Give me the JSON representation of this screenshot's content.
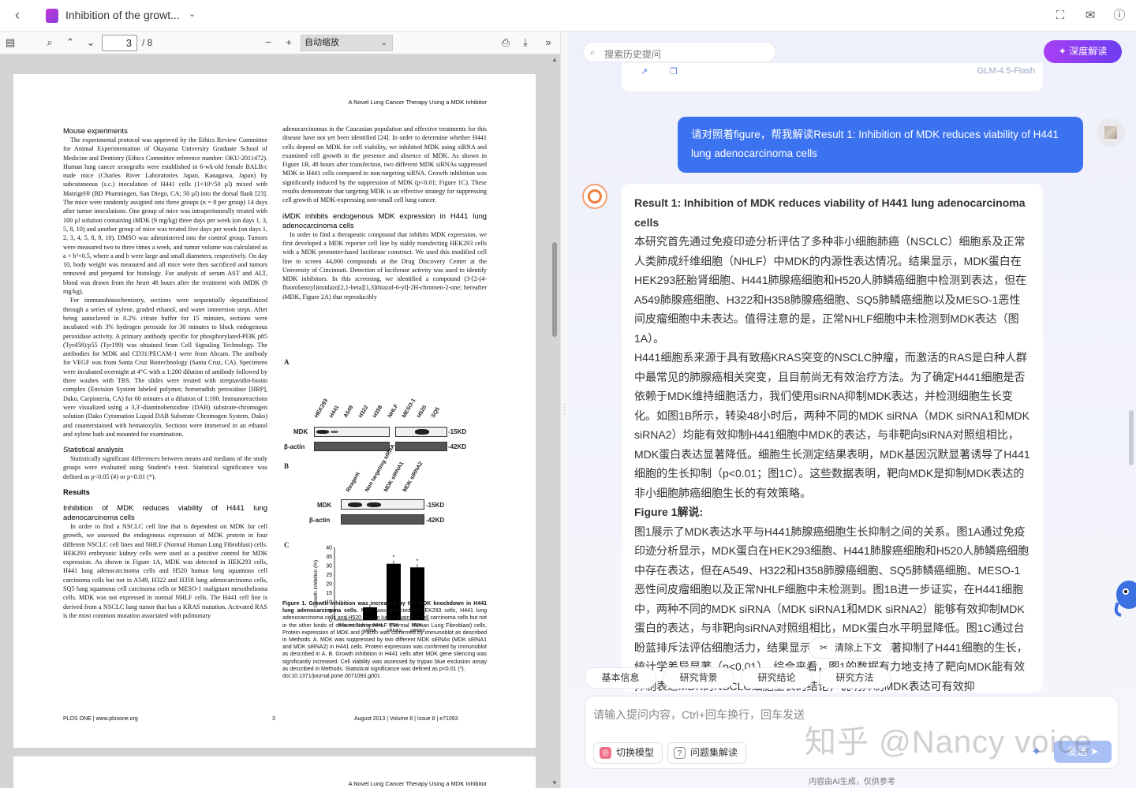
{
  "window": {
    "doc_title": "Inhibition of the growt...",
    "icons": [
      "back-icon",
      "fullscreen-icon",
      "feedback-icon",
      "help-icon"
    ]
  },
  "pdf_toolbar": {
    "page_current": "3",
    "page_total": "/ 8",
    "zoom_label": "自动缩放"
  },
  "pdf": {
    "running_head": "A Novel Lung Cancer Therapy Using a MDK Inhibitor",
    "col1": [
      {
        "type": "h",
        "text": "Mouse experiments"
      },
      {
        "type": "p",
        "text": "The experimental protocol was approved by the Ethics Review Committee for Animal Experimentation of Okayama University Graduate School of Medicine and Dentistry (Ethics Committee reference number: OKU-2011472). Human lung cancer xenografts were established in 6-wk-old female BALB/c nude mice (Charles River Laboratories Japan, Kanagawa, Japan) by subcutaneous (s.c.) inoculation of H441 cells (1×10⁶/50 µl) mixed with Matrigel® (BD Pharmingen, San Diego, CA; 50 µl) into the dorsal flank [23]. The mice were randomly assigned into three groups (n = 8 per group) 14 days after tumor inoculations. One group of mice was intraperitoneally treated with 100 µl solution containing iMDK (9 mg/kg) three days per week (on days 1, 3, 5, 8, 10) and another group of mice was treated five days per week (on days 1, 2, 3, 4, 5, 8, 9, 10). DMSO was administered into the control group. Tumors were measured two to three times a week, and tumor volume was calculated as a × b²×0.5, where a and b were large and small diameters, respectively. On day 10, body weight was measured and all mice were then sacrificed and tumors removed and prepared for histology. For analysis of serum AST and ALT, blood was drawn from the heart 48 hours after the treatment with iMDK (9 mg/kg)."
      },
      {
        "type": "p",
        "text": "For immunohistochemistry, sections were sequentially deparaffinized through a series of xylene, graded ethanol, and water immersion steps. After being autoclaved in 0.2% citrate buffer for 15 minutes, sections were incubated with 3% hydrogen peroxide for 30 minutes to block endogenous peroxidase activity. A primary antibody specific for phosphorylated-PI3K p85 (Tyr458)/p55 (Tyr199) was obtained from Cell Signaling Technology. The antibodies for MDK and CD31/PECAM-1 were from Abcam. The antibody for VEGF was from Santa Cruz Biotechnology (Santa Cruz, CA). Specimens were incubated overnight at 4°C with a 1:200 dilution of antibody followed by three washes with TBS. The slides were treated with streptavidin-biotin complex (Envision System labeled polymer, horseradish peroxidase [HRP], Dako, Carpinteria, CA) for 60 minutes at a dilution of 1:100. Immunoreactions were visualized using a 3,3′-diaminobenzidine (DAB) substrate-chromogen solution (Dako Cytomation Liquid DAB Substrate Chromogen System, Dako) and counterstained with hematoxylin. Sections were immersed in an ethanol and xylene bath and mounted for examination."
      },
      {
        "type": "h",
        "text": "Statistical analysis"
      },
      {
        "type": "p",
        "text": "Statistically significant differences between means and medians of the study groups were evaluated using Student's t-test. Statistical significance was defined as p<0.05 (#) or p<0.01 (*)."
      },
      {
        "type": "hb",
        "text": "Results"
      },
      {
        "type": "h",
        "text": "Inhibition of MDK reduces viability of H441 lung adenocarcinoma cells"
      },
      {
        "type": "p",
        "text": "In order to find a NSCLC cell line that is dependent on MDK for cell growth, we assessed the endogenous expression of MDK protein in four different NSCLC cell lines and NHLF (Normal Human Lung Fibroblast) cells. HEK293 embryonic kidney cells were used as a positive control for MDK expression. As shown in Figure 1A, MDK was detected in HEK293 cells, H441 lung adenocarcinoma cells and H520 human lung squamous cell carcinoma cells but not in A549, H322 and H358 lung adenocarcinoma cells, SQ5 lung squamous cell carcinoma cells or MESO-1 malignant mesothelioma cells. MDK was not expressed in normal NHLF cells. The H441 cell line is derived from a NSCLC lung tumor that has a KRAS mutation. Activated RAS is the most common mutation associated with pulmonary"
      }
    ],
    "col2": [
      {
        "type": "p0",
        "text": "adenocarcinomas in the Caucasian population and effective treatments for this disease have not yet been identified [24]. In order to determine whether H441 cells depend on MDK for cell viability, we inhibited MDK using siRNA and examined cell growth in the presence and absence of MDK. As shown in Figure 1B, 48 hours after transfection, two different MDK siRNAs suppressed MDK in H441 cells compared to non-targeting siRNA. Growth inhibition was significantly induced by the suppression of MDK (p<0.01; Figure 1C). These results demonstrate that targeting MDK is an effective strategy for suppressing cell growth of MDK-expressing non-small cell lung cancer."
      },
      {
        "type": "h",
        "text": "iMDK inhibits endogenous MDK expression in H441 lung adenocarcinoma cells"
      },
      {
        "type": "p",
        "text": "In order to find a therapeutic compound that inhibits MDK expression, we first developed a MDK reporter cell line by stably transfecting HEK293 cells with a MDK promoter-fused luciferase construct. We used this modified cell line to screen 44,000 compounds at the Drug Discovery Center at the University of Cincinnati. Detection of luciferase activity was used to identify MDK inhibitors. In this screening, we identified a compound (3-[2-(4-fluorobenzyl)imidazo[2,1-beta][1,3]thiazol-6-yl]-2H-chromen-2-one; hereafter iMDK, Figure 2A) that reproducibly"
      }
    ],
    "figure": {
      "panel_a": "A",
      "panel_b": "B",
      "panel_c": "C",
      "a_lanes": [
        "HEK293",
        "H441",
        "A549",
        "H322",
        "H358",
        "NHLF",
        "MESO-1",
        "H520",
        "SQ5"
      ],
      "b_lanes": [
        "Reagent",
        "Non targeting siRNA",
        "MDK siRNA1",
        "MDK siRNA2"
      ],
      "mdk": "MDK",
      "actin": "β-actin",
      "kd15": "-15KD",
      "kd42": "-42KD",
      "c_ylabel": "Growth inhibition (%)",
      "c_yticks": [
        "40",
        "35",
        "30",
        "25",
        "20",
        "15",
        "10",
        "5",
        "0"
      ],
      "c_cats": [
        "Reagent",
        "Non targeting siRNA",
        "MDK siRNA1",
        "MDK siRNA2"
      ],
      "star": "*"
    },
    "caption_bold": "Figure 1. Growth inhibition was increased by the MDK knockdown in H441 lung adenocarcinoma cells.",
    "caption_text": " MDK was detected in HEK293 cells, H441 lung adenocarcinoma cells and H520 human lung squamous cell carcinoma cells but not in the other kinds of cells including NHLF (Normal Human Lung Fibroblast) cells. Protein expression of MDK and β-actin was confirmed by immunoblot as described in Methods. A. MDK was suppressed by two different MDK siRNAs (MDK siRNA1 and MDK siRNA2) in H441 cells. Protein expression was confirmed by immunoblot as described in A. B. Growth inhibition in H441 cells after MDK gene silencing was significantly increased. Cell viability was assessed by trypan blue exclusion assay as described in Methods. Statistical significance was defined as p<0.01 (*).",
    "caption_doi": "doi:10.1371/journal.pone.0071093.g001",
    "footer_left": "PLOS ONE | www.plosone.org",
    "footer_center": "3",
    "footer_right": "August 2013 | Volume 8 | Issue 8 | e71093",
    "next_running_head": "A Novel Lung Cancer Therapy Using a MDK Inhibitor"
  },
  "chart_data": {
    "type": "bar",
    "categories": [
      "Reagent",
      "Non targeting siRNA",
      "MDK siRNA1",
      "MDK siRNA2"
    ],
    "values": [
      0,
      7,
      31,
      29
    ],
    "ylabel": "Growth inhibition (%)",
    "ylim": [
      0,
      40
    ]
  },
  "right_panel": {
    "search_placeholder": "搜索历史提问",
    "deep_button": "深度解读",
    "prev_model_tag": "GLM-4.5-Flash",
    "user_message": "请对照着figure，帮我解读Result 1: Inhibition of MDK reduces viability of H441 lung adenocarcinoma cells",
    "answer_title": "Result 1: Inhibition of MDK reduces viability of H441 lung adenocarcinoma cells",
    "answer_p1": "本研究首先通过免疫印迹分析评估了多种非小细胞肺癌（NSCLC）细胞系及正常人类肺成纤维细胞（NHLF）中MDK的内源性表达情况。结果显示，MDK蛋白在HEK293胚胎肾细胞、H441肺腺癌细胞和H520人肺鳞癌细胞中检测到表达，但在A549肺腺癌细胞、H322和H358肺腺癌细胞、SQ5肺鳞癌细胞以及MESO-1恶性间皮瘤细胞中未表达。值得注意的是，正常NHLF细胞中未检测到MDK表达（图1A）。",
    "answer_p2": "H441细胞系来源于具有致癌KRAS突变的NSCLC肿瘤，而激活的RAS是白种人群中最常见的肺腺癌相关突变，且目前尚无有效治疗方法。为了确定H441细胞是否依赖于MDK维持细胞活力，我们使用siRNA抑制MDK表达，并检测细胞生长变化。如图1B所示，转染48小时后，两种不同的MDK siRNA（MDK siRNA1和MDK siRNA2）均能有效抑制H441细胞中MDK的表达，与非靶向siRNA对照组相比，MDK蛋白表达显著降低。细胞生长测定结果表明，MDK基因沉默显著诱导了H441细胞的生长抑制（p<0.01；图1C）。这些数据表明，靶向MDK是抑制MDK表达的非小细胞肺癌细胞生长的有效策略。",
    "answer_h2": "Figure 1解说:",
    "answer_p3": "图1展示了MDK表达水平与H441肺腺癌细胞生长抑制之间的关系。图1A通过免疫印迹分析显示，MDK蛋白在HEK293细胞、H441肺腺癌细胞和H520人肺鳞癌细胞中存在表达，但在A549、H322和H358肺腺癌细胞、SQ5肺鳞癌细胞、MESO-1恶性间皮瘤细胞以及正常NHLF细胞中未检测到。图1B进一步证实，在H441细胞中，两种不同的MDK siRNA（MDK siRNA1和MDK siRNA2）能够有效抑制MDK蛋白的表达，与非靶向siRNA对照组相比，MDK蛋白水平明显降低。图1C通过台盼蓝排斥法评估细胞活力，结果显示MDK基因沉默显著抑制了H441细胞的生长，统计学差异显著（p<0.01）。综合来看，图1的数据有力地支持了靶向MDK能有效抑制表达MDK的NSCLC细胞生长的结论，说明抑制MDK表达可有效抑",
    "clear_context": "清除上下文",
    "chips": [
      "基本信息",
      "研究背景",
      "研究结论",
      "研究方法"
    ],
    "input_placeholder": "请输入提问内容，Ctrl+回车换行，回车发送",
    "switch_model": "切换模型",
    "question_set": "问题集解读",
    "send": "发送",
    "ai_note": "内容由AI生成，仅供参考",
    "watermark": "知乎 @Nancy voice"
  }
}
